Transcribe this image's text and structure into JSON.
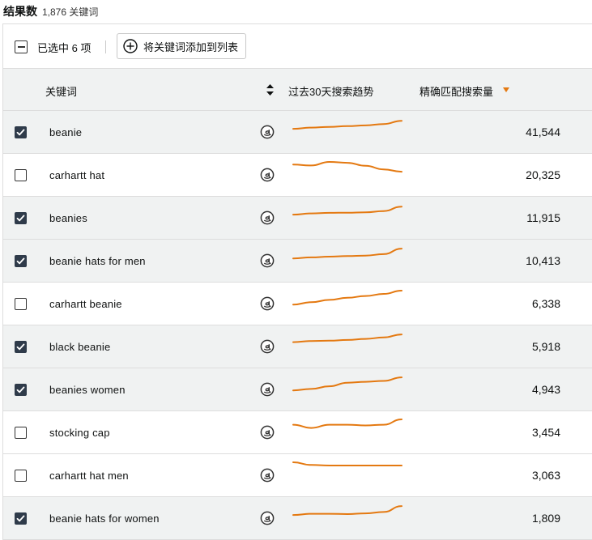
{
  "results": {
    "title": "结果数",
    "count": "1,876 关键词"
  },
  "toolbar": {
    "selected_label": "已选中 6 项",
    "add_label": "将关键词添加到列表"
  },
  "columns": {
    "keyword": "关键词",
    "trend": "过去30天搜索趋势",
    "volume": "精确匹配搜索量"
  },
  "accent_color": "#e47911",
  "rows": [
    {
      "keyword": "beanie",
      "volume": "41,544",
      "checked": true,
      "trend": [
        0.55,
        0.48,
        0.44,
        0.4,
        0.36,
        0.28,
        0.1
      ]
    },
    {
      "keyword": "carhartt hat",
      "volume": "20,325",
      "checked": false,
      "trend": [
        0.15,
        0.2,
        0.0,
        0.05,
        0.22,
        0.42,
        0.55
      ]
    },
    {
      "keyword": "beanies",
      "volume": "11,915",
      "checked": true,
      "trend": [
        0.55,
        0.48,
        0.45,
        0.44,
        0.42,
        0.35,
        0.1
      ]
    },
    {
      "keyword": "beanie hats for men",
      "volume": "10,413",
      "checked": true,
      "trend": [
        0.6,
        0.54,
        0.5,
        0.47,
        0.44,
        0.36,
        0.05
      ]
    },
    {
      "keyword": "carhartt beanie",
      "volume": "6,338",
      "checked": false,
      "trend": [
        0.78,
        0.65,
        0.52,
        0.4,
        0.3,
        0.18,
        0.0
      ]
    },
    {
      "keyword": "black beanie",
      "volume": "5,918",
      "checked": true,
      "trend": [
        0.48,
        0.42,
        0.4,
        0.36,
        0.3,
        0.22,
        0.05
      ]
    },
    {
      "keyword": "beanies women",
      "volume": "4,943",
      "checked": true,
      "trend": [
        0.78,
        0.7,
        0.55,
        0.35,
        0.3,
        0.25,
        0.05
      ]
    },
    {
      "keyword": "stocking cap",
      "volume": "3,454",
      "checked": false,
      "trend": [
        0.3,
        0.48,
        0.3,
        0.3,
        0.34,
        0.3,
        0.0
      ]
    },
    {
      "keyword": "carhartt hat men",
      "volume": "3,063",
      "checked": false,
      "trend": [
        0.0,
        0.15,
        0.18,
        0.18,
        0.18,
        0.18,
        0.18
      ]
    },
    {
      "keyword": "beanie hats for women",
      "volume": "1,809",
      "checked": true,
      "trend": [
        0.55,
        0.48,
        0.48,
        0.5,
        0.46,
        0.38,
        0.05
      ]
    }
  ]
}
